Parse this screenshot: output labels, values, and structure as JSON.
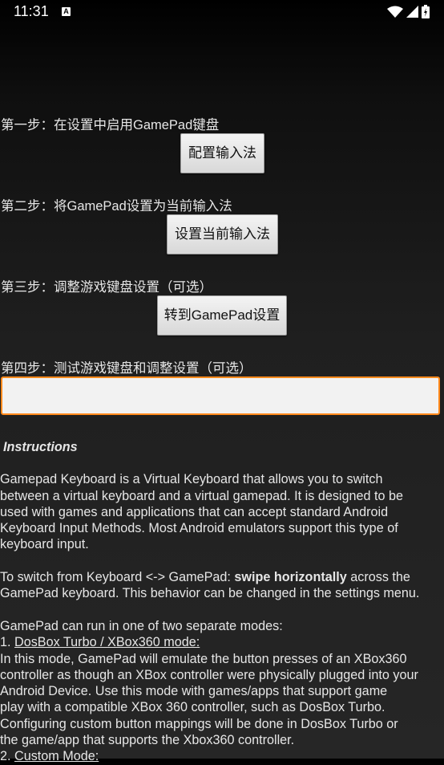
{
  "status_bar": {
    "time": "11:31",
    "notification_icon_letter": "A",
    "icons": [
      "wifi-icon",
      "signal-icon",
      "battery-icon"
    ]
  },
  "steps": [
    {
      "label": "第一步：在设置中启用GamePad键盘",
      "button": "配置输入法"
    },
    {
      "label": "第二步：将GamePad设置为当前输入法",
      "button": "设置当前输入法"
    },
    {
      "label": "第三步：调整游戏键盘设置（可选）",
      "button": "转到GamePad设置"
    },
    {
      "label": "第四步：测试游戏键盘和调整设置（可选）"
    }
  ],
  "test_input": {
    "value": "",
    "focus_color": "#ff8a1c"
  },
  "instructions": {
    "title": "Instructions",
    "p1": [
      " Gamepad Keyboard is a Virtual Keyboard that allows you to switch",
      "between a virtual keyboard and a virtual gamepad. It is designed to be",
      "used with games and applications that can accept standard Android",
      "Keyboard Input Methods. Most Android emulators support this type of",
      "keyboard input."
    ],
    "p2_prefix": " To switch from Keyboard <-> GamePad: ",
    "p2_bold": "swipe horizontally",
    "p2_suffix": " across the",
    "p2_line2": "GamePad keyboard. This behavior can be changed in the settings menu.",
    "p3_line1": " GamePad can run in one of two separate modes:",
    "mode1_prefix": " 1. ",
    "mode1_title": "DosBox Turbo / XBox360 mode:",
    "mode1_lines": [
      " In this mode, GamePad will emulate the button presses of an XBox360",
      "controller as though an XBox controller were physically plugged into your",
      "Android Device. Use this mode with games/apps that support game",
      "play with a compatible XBox 360 controller, such as DosBox Turbo.",
      "Configuring custom button mappings will be done in DosBox Turbo or",
      "the game/app that supports the Xbox360 controller."
    ],
    "mode2_prefix": " 2. ",
    "mode2_title": "Custom Mode:"
  }
}
